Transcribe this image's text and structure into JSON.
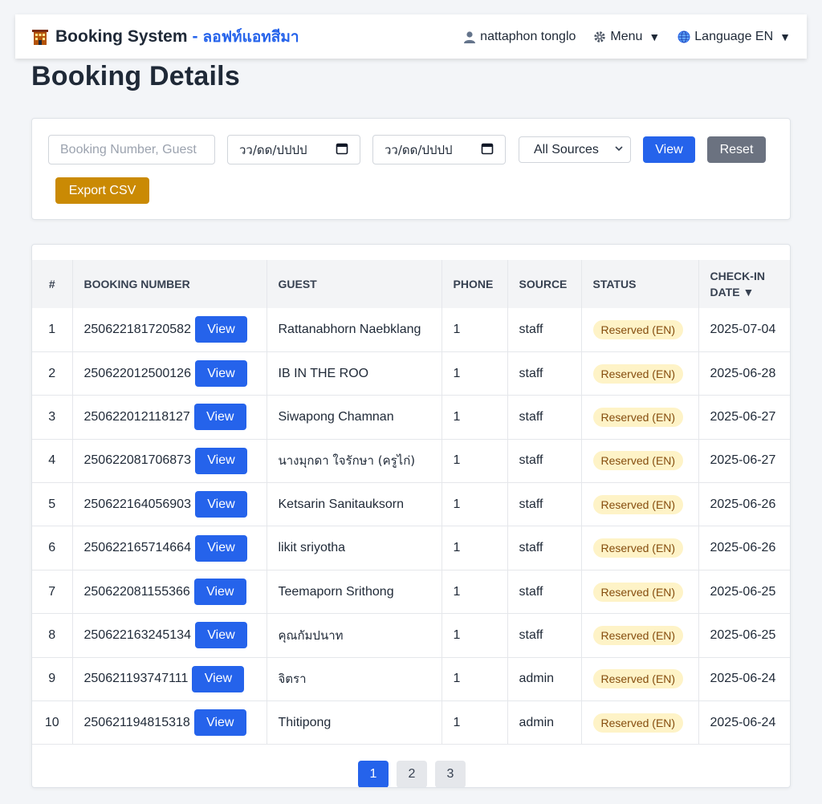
{
  "navbar": {
    "brand_title": "Booking System",
    "brand_separator": "-",
    "brand_subtitle": "ลอฟท์แอทสีมา",
    "user_name": "nattaphon tonglo",
    "menu_label": "Menu",
    "language_label": "Language EN",
    "caret": "▼"
  },
  "page": {
    "title": "Booking Details"
  },
  "filters": {
    "search_placeholder": "Booking Number, Guest",
    "date_from": "วว/ดด/ปปปป",
    "date_to": "วว/ดด/ปปปป",
    "source_selected": "All Sources",
    "view_label": "View",
    "reset_label": "Reset",
    "export_label": "Export CSV"
  },
  "table": {
    "headers": {
      "num": "#",
      "booking_number": "BOOKING NUMBER",
      "guest": "GUEST",
      "phone": "PHONE",
      "source": "SOURCE",
      "status": "STATUS",
      "checkin_line1": "CHECK-IN",
      "checkin_line2": "DATE ▼"
    },
    "view_label": "View",
    "rows": [
      {
        "num": "1",
        "booking": "250622181720582",
        "guest": "Rattanabhorn Naebklang",
        "phone": "1",
        "source": "staff",
        "status": "Reserved (EN)",
        "date": "2025-07-04"
      },
      {
        "num": "2",
        "booking": "250622012500126",
        "guest": "IB IN THE ROO",
        "phone": "1",
        "source": "staff",
        "status": "Reserved (EN)",
        "date": "2025-06-28"
      },
      {
        "num": "3",
        "booking": "250622012118127",
        "guest": "Siwapong Chamnan",
        "phone": "1",
        "source": "staff",
        "status": "Reserved (EN)",
        "date": "2025-06-27"
      },
      {
        "num": "4",
        "booking": "250622081706873",
        "guest": "นางมุกดา ใจรักษา (ครูไก่)",
        "phone": "1",
        "source": "staff",
        "status": "Reserved (EN)",
        "date": "2025-06-27"
      },
      {
        "num": "5",
        "booking": "250622164056903",
        "guest": "Ketsarin Sanitauksorn",
        "phone": "1",
        "source": "staff",
        "status": "Reserved (EN)",
        "date": "2025-06-26"
      },
      {
        "num": "6",
        "booking": "250622165714664",
        "guest": "likit sriyotha",
        "phone": "1",
        "source": "staff",
        "status": "Reserved (EN)",
        "date": "2025-06-26"
      },
      {
        "num": "7",
        "booking": "250622081155366",
        "guest": "Teemaporn Srithong",
        "phone": "1",
        "source": "staff",
        "status": "Reserved (EN)",
        "date": "2025-06-25"
      },
      {
        "num": "8",
        "booking": "250622163245134",
        "guest": "คุณกัมปนาท",
        "phone": "1",
        "source": "staff",
        "status": "Reserved (EN)",
        "date": "2025-06-25"
      },
      {
        "num": "9",
        "booking": "250621193747111",
        "guest": "จิตรา",
        "phone": "1",
        "source": "admin",
        "status": "Reserved (EN)",
        "date": "2025-06-24"
      },
      {
        "num": "10",
        "booking": "250621194815318",
        "guest": "Thitipong",
        "phone": "1",
        "source": "admin",
        "status": "Reserved (EN)",
        "date": "2025-06-24"
      }
    ]
  },
  "pagination": {
    "pages": [
      "1",
      "2",
      "3"
    ],
    "active": "1"
  },
  "colors": {
    "primary": "#2563eb",
    "secondary": "#6b7280",
    "warning": "#ca8a04",
    "badge_bg": "#fef3c7"
  }
}
